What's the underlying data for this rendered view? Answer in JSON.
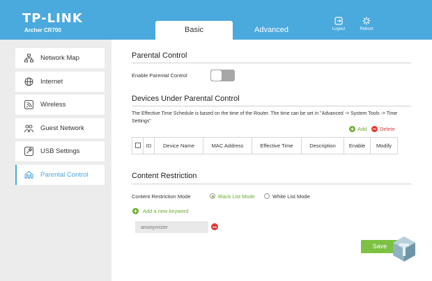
{
  "header": {
    "logo": "TP-LINK",
    "model": "Archer CR700",
    "tabs": [
      {
        "label": "Basic",
        "active": true
      },
      {
        "label": "Advanced",
        "active": false
      }
    ],
    "buttons": [
      {
        "label": "Logout",
        "icon": "logout-icon"
      },
      {
        "label": "Reboot",
        "icon": "reboot-icon"
      }
    ]
  },
  "sidebar": {
    "items": [
      {
        "label": "Network Map",
        "icon": "network-map-icon"
      },
      {
        "label": "Internet",
        "icon": "globe-icon"
      },
      {
        "label": "Wireless",
        "icon": "wireless-icon"
      },
      {
        "label": "Guest Network",
        "icon": "guest-network-icon"
      },
      {
        "label": "USB Settings",
        "icon": "usb-icon"
      },
      {
        "label": "Parental Control",
        "icon": "parental-control-icon",
        "active": true
      }
    ]
  },
  "main": {
    "parental_control": {
      "title": "Parental Control",
      "enable_label": "Enable Parental Control",
      "enabled": false
    },
    "devices": {
      "title": "Devices Under Parental Control",
      "description": "The Effective Time Schedule is based on the time of the Router. The time can be set in \"Advanced -> System Tools -> Time Settings\"",
      "add_label": "Add",
      "delete_label": "Delete",
      "columns": [
        "",
        "ID",
        "Device Name",
        "MAC Address",
        "Effective Time",
        "Description",
        "Enable",
        "Modify"
      ]
    },
    "content_restriction": {
      "title": "Content Restriction",
      "mode_label": "Content Restriction Mode",
      "modes": [
        {
          "label": "Black List Mode",
          "selected": true
        },
        {
          "label": "White List Mode",
          "selected": false
        }
      ],
      "add_keyword_label": "Add a new keyword",
      "keyword_placeholder": "anonymizer"
    },
    "save_label": "Save"
  },
  "colors": {
    "header_blue": "#4aa9dd",
    "accent_green": "#7cc142",
    "delete_red": "#e23a3a"
  }
}
